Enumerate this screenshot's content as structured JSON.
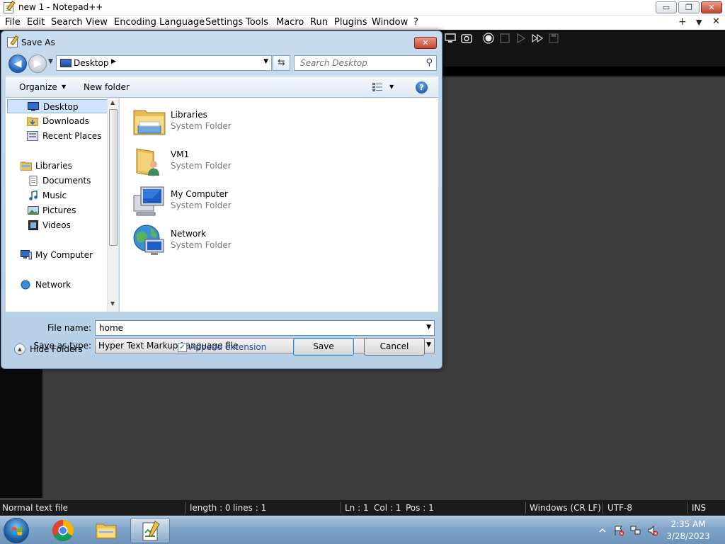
{
  "window": {
    "title": "new 1 - Notepad++",
    "minimize_label": "▭",
    "restore_label": "❐",
    "close_label": "✕"
  },
  "menu": {
    "items": [
      "File",
      "Edit",
      "Search",
      "View",
      "Encoding",
      "Language",
      "Settings",
      "Tools",
      "Macro",
      "Run",
      "Plugins",
      "Window",
      "?"
    ],
    "right_controls": [
      "+",
      "▼",
      "✕"
    ]
  },
  "status_bar": {
    "file_type": "Normal text file",
    "length": "length : 0",
    "lines": "lines : 1",
    "ln": "Ln : 1",
    "col": "Col : 1",
    "pos": "Pos : 1",
    "eol": "Windows (CR LF)",
    "encoding": "UTF-8",
    "mode": "INS"
  },
  "dialog": {
    "title": "Save As",
    "close_label": "✕",
    "address": "Desktop",
    "search_placeholder": "Search Desktop",
    "organize_label": "Organize",
    "new_folder_label": "New folder",
    "nav_items": [
      {
        "label": "Desktop",
        "icon": "desktop-icon",
        "selected": true
      },
      {
        "label": "Downloads",
        "icon": "downloads-folder-icon"
      },
      {
        "label": "Recent Places",
        "icon": "recent-places-icon"
      },
      {
        "label": "Libraries",
        "icon": "libraries-icon"
      },
      {
        "label": "Documents",
        "icon": "documents-icon"
      },
      {
        "label": "Music",
        "icon": "music-icon"
      },
      {
        "label": "Pictures",
        "icon": "pictures-icon"
      },
      {
        "label": "Videos",
        "icon": "videos-icon"
      },
      {
        "label": "My Computer",
        "icon": "computer-icon"
      },
      {
        "label": "Network",
        "icon": "network-icon"
      }
    ],
    "files": [
      {
        "name": "Libraries",
        "type": "System Folder",
        "icon": "libraries-folder-icon"
      },
      {
        "name": "VM1",
        "type": "System Folder",
        "icon": "user-folder-icon"
      },
      {
        "name": "My Computer",
        "type": "System Folder",
        "icon": "computer-icon"
      },
      {
        "name": "Network",
        "type": "System Folder",
        "icon": "network-icon"
      }
    ],
    "file_name_label": "File name:",
    "file_name_value": "home",
    "save_as_type_label": "Save as type:",
    "save_as_type_value": "Hyper Text Markup Language file",
    "hide_folders_label": "Hide Folders",
    "append_extension_label": "Append extension",
    "append_extension_checked": true,
    "save_label": "Save",
    "cancel_label": "Cancel"
  },
  "taskbar": {
    "time": "2:35 AM",
    "date": "3/28/2023"
  },
  "colors": {
    "editor_bg": "#3c3c3c",
    "toolbar_bg": "#141414",
    "dialog_frame": "#b7cfe7",
    "taskbar": "#7fa4c8",
    "selection": "#cfe4fa"
  }
}
